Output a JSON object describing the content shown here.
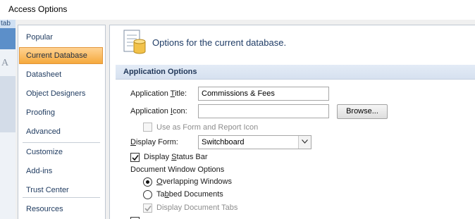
{
  "window": {
    "title": "Access Options"
  },
  "background": {
    "tab_hint": "tab",
    "letter_glyph": "A"
  },
  "nav": {
    "items": [
      {
        "label": "Popular"
      },
      {
        "label": "Current Database"
      },
      {
        "label": "Datasheet"
      },
      {
        "label": "Object Designers"
      },
      {
        "label": "Proofing"
      },
      {
        "label": "Advanced"
      },
      {
        "label": "Customize"
      },
      {
        "label": "Add-ins"
      },
      {
        "label": "Trust Center"
      },
      {
        "label": "Resources"
      }
    ],
    "active_index": 1
  },
  "main": {
    "intro": "Options for the current database.",
    "section_title": "Application Options",
    "app_title": {
      "label_pre": "Application ",
      "label_key": "T",
      "label_post": "itle:",
      "value": "Commissions & Fees"
    },
    "app_icon": {
      "label_pre": "Application ",
      "label_key": "I",
      "label_post": "con:",
      "value": "",
      "browse_label": "Browse..."
    },
    "use_as_icon": {
      "label": "Use as Form and Report Icon",
      "checked": false,
      "enabled": false
    },
    "display_form": {
      "label_key": "D",
      "label_post": "isplay Form:",
      "value": "Switchboard"
    },
    "display_status_bar": {
      "label_pre": "Display ",
      "label_key": "S",
      "label_post": "tatus Bar",
      "checked": true
    },
    "doc_window_options": {
      "label": "Document Window Options"
    },
    "overlapping": {
      "label_key": "O",
      "label_post": "verlapping Windows",
      "selected": true
    },
    "tabbed": {
      "label_pre": "Ta",
      "label_key": "b",
      "label_post": "bed Documents",
      "selected": false
    },
    "display_doc_tabs": {
      "label": "Display Document Tabs",
      "checked": true,
      "enabled": false
    }
  },
  "colors": {
    "accent": "#f5a93c",
    "section_header": "#dfe8f4",
    "heading_text": "#1f3c66"
  }
}
